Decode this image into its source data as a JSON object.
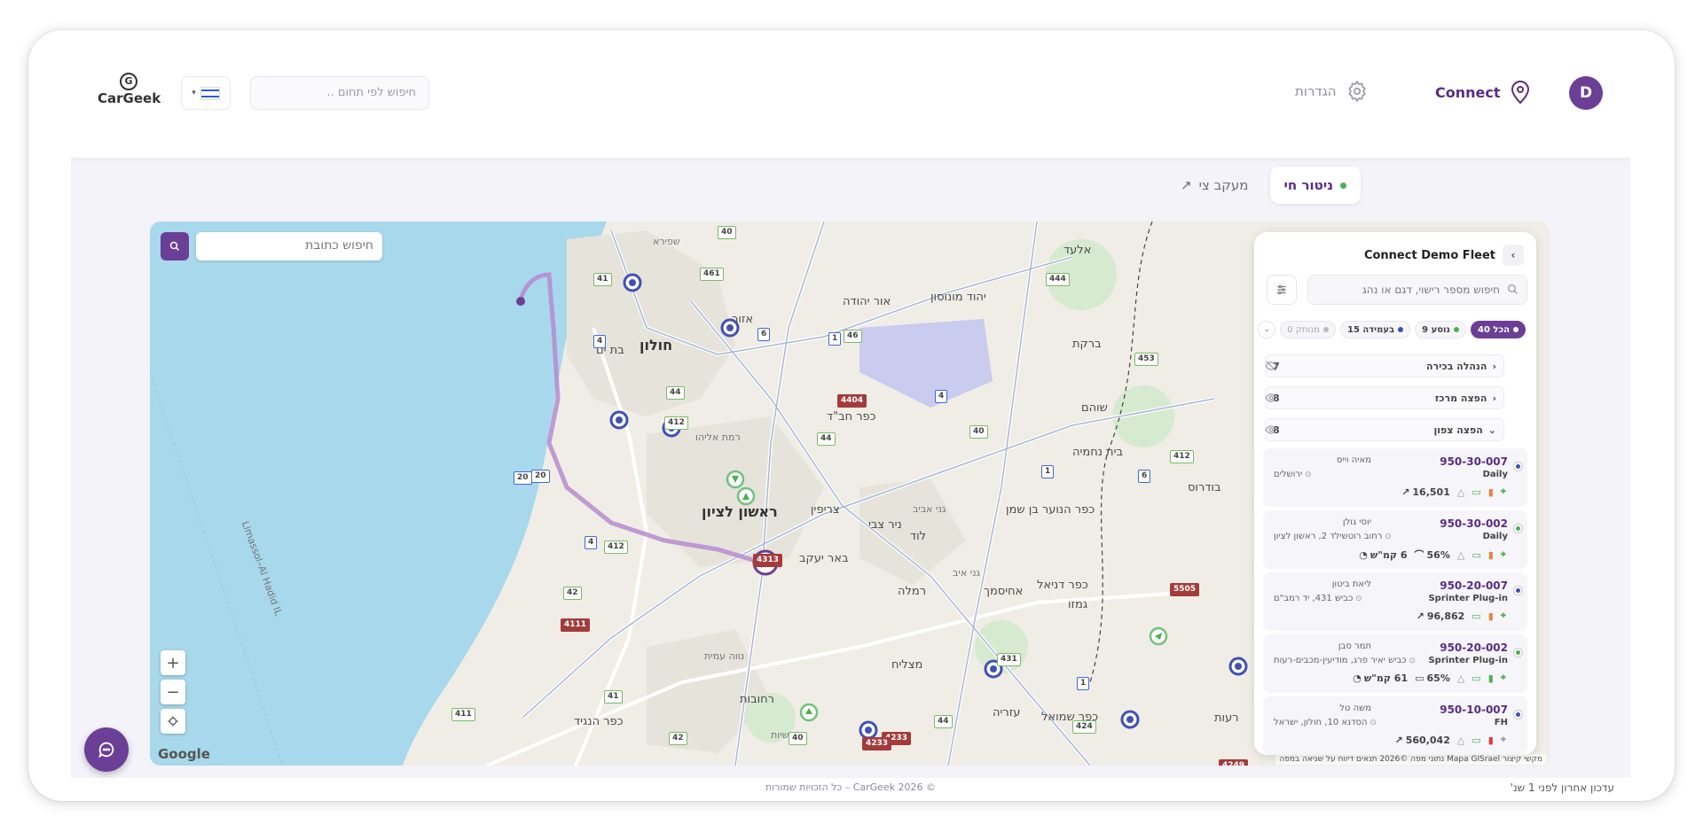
{
  "header": {
    "avatar_initial": "D",
    "connect_label": "Connect",
    "settings_label": "הגדרות",
    "search_placeholder": "חיפוש לפי תחום ..",
    "logo_text_a": "Car",
    "logo_text_b": "Geek",
    "logo_mark": "G"
  },
  "tabs": [
    {
      "label": "ניטור חי",
      "active": true
    },
    {
      "label": "מעקב צי",
      "active": false
    }
  ],
  "map": {
    "address_placeholder": "חיפוש כתובת",
    "zoom_in": "+",
    "zoom_out": "−",
    "google_label": "Google",
    "attribution": "מקשי קיצור   Mapa GISrael נתוני מפה ©2026   תנאים   דיווח על שגיאה במפה",
    "place_labels": [
      {
        "text": "חולון",
        "big": true
      },
      {
        "text": "בת ים"
      },
      {
        "text": "ראשון לציון",
        "big": true
      },
      {
        "text": "אזור"
      },
      {
        "text": "אור יהודה"
      },
      {
        "text": "יהוד מונוסון"
      },
      {
        "text": "אלעד"
      },
      {
        "text": "ברקת"
      },
      {
        "text": "שוהם"
      },
      {
        "text": "בית נחמיה"
      },
      {
        "text": "בודרוס"
      },
      {
        "text": "כפר חב\"ד"
      },
      {
        "text": "צריפין"
      },
      {
        "text": "ניר צבי"
      },
      {
        "text": "לוד"
      },
      {
        "text": "כפר הנוער בן שמן"
      },
      {
        "text": "באר יעקב"
      },
      {
        "text": "רמלה"
      },
      {
        "text": "אחיסמך"
      },
      {
        "text": "כפר דניאל"
      },
      {
        "text": "גמזו"
      },
      {
        "text": "מצליח"
      },
      {
        "text": "רחובות"
      },
      {
        "text": "עזריה"
      },
      {
        "text": "כפר שמואל"
      },
      {
        "text": "כפר הנגיד"
      },
      {
        "text": "גני אביב",
        "small": true
      },
      {
        "text": "גני איב",
        "small": true
      },
      {
        "text": "נווה עמית",
        "small": true
      },
      {
        "text": "רמת אליהו",
        "small": true
      },
      {
        "text": "אושיות",
        "small": true
      },
      {
        "text": "שפירא",
        "small": true
      },
      {
        "text": "רעות"
      },
      {
        "text": "Limassol–Al Hadid IL",
        "small": true
      }
    ],
    "road_shields": [
      "40",
      "41",
      "4",
      "461",
      "412",
      "1",
      "6",
      "44",
      "46",
      "444",
      "453",
      "6",
      "4404",
      "4",
      "412",
      "44",
      "40",
      "1",
      "5505",
      "20",
      "42",
      "4",
      "4313",
      "412",
      "431",
      "1",
      "41",
      "411",
      "4111",
      "42",
      "4233",
      "4233",
      "40",
      "424",
      "4249",
      "44",
      "20"
    ]
  },
  "panel": {
    "title": "Connect Demo Fleet",
    "search_placeholder": "חיפוש מספר רישוי, דגם או נהג",
    "chips": [
      {
        "label": "הכל 40",
        "color": "#ffffff"
      },
      {
        "label": "נוסע 9",
        "color": "#4caf50"
      },
      {
        "label": "בעמידה 15",
        "color": "#3f51b5"
      },
      {
        "label": "מנותק 0",
        "color": "#bbbbbb"
      }
    ],
    "groups": [
      {
        "name": "הנהלה בכירה",
        "count": "7"
      },
      {
        "name": "הפצה מרכז",
        "count": "8"
      },
      {
        "name": "הפצה צפון",
        "count": "8"
      }
    ],
    "vehicles": [
      {
        "plate": "950-30-007",
        "type": "Daily",
        "driver": "מאיה וייס",
        "location": "ירושלים",
        "status_color": "#3f51b5",
        "stats": [
          "16,501"
        ]
      },
      {
        "plate": "950-30-002",
        "type": "Daily",
        "driver": "יוסי גולן",
        "location": "רחוב רוטשילד 2, ראשון לציון",
        "status_color": "#4caf50",
        "stats": [
          "56%",
          "6 קמ\"ש"
        ]
      },
      {
        "plate": "950-20-007",
        "type": "Sprinter Plug-in",
        "driver": "ליאת ביטון",
        "location": "כביש 431, יד רמב\"ם",
        "status_color": "#3f51b5",
        "stats": [
          "96,862"
        ]
      },
      {
        "plate": "950-20-002",
        "type": "Sprinter Plug-in",
        "driver": "תמר סבן",
        "location": "כביש יאיר פרג, מודיעין-מכבים-רעות",
        "status_color": "#4caf50",
        "stats": [
          "65%",
          "61 קמ\"ש"
        ]
      },
      {
        "plate": "950-10-007",
        "type": "FH",
        "driver": "משה טל",
        "location": "הסדנא 10, חולון, ישראל",
        "status_color": "#3f51b5",
        "stats": [
          "560,042"
        ]
      }
    ]
  },
  "footer": {
    "copyright": "© CarGeek 2026 – כל הזכויות שמורות",
    "updated": "עדכון אחרון לפני 1 שנ'"
  },
  "colors": {
    "brand": "#6b3f96",
    "sea": "#a8d8ec",
    "land": "#efede5",
    "moving": "#4caf50",
    "parked": "#3f51b5"
  }
}
